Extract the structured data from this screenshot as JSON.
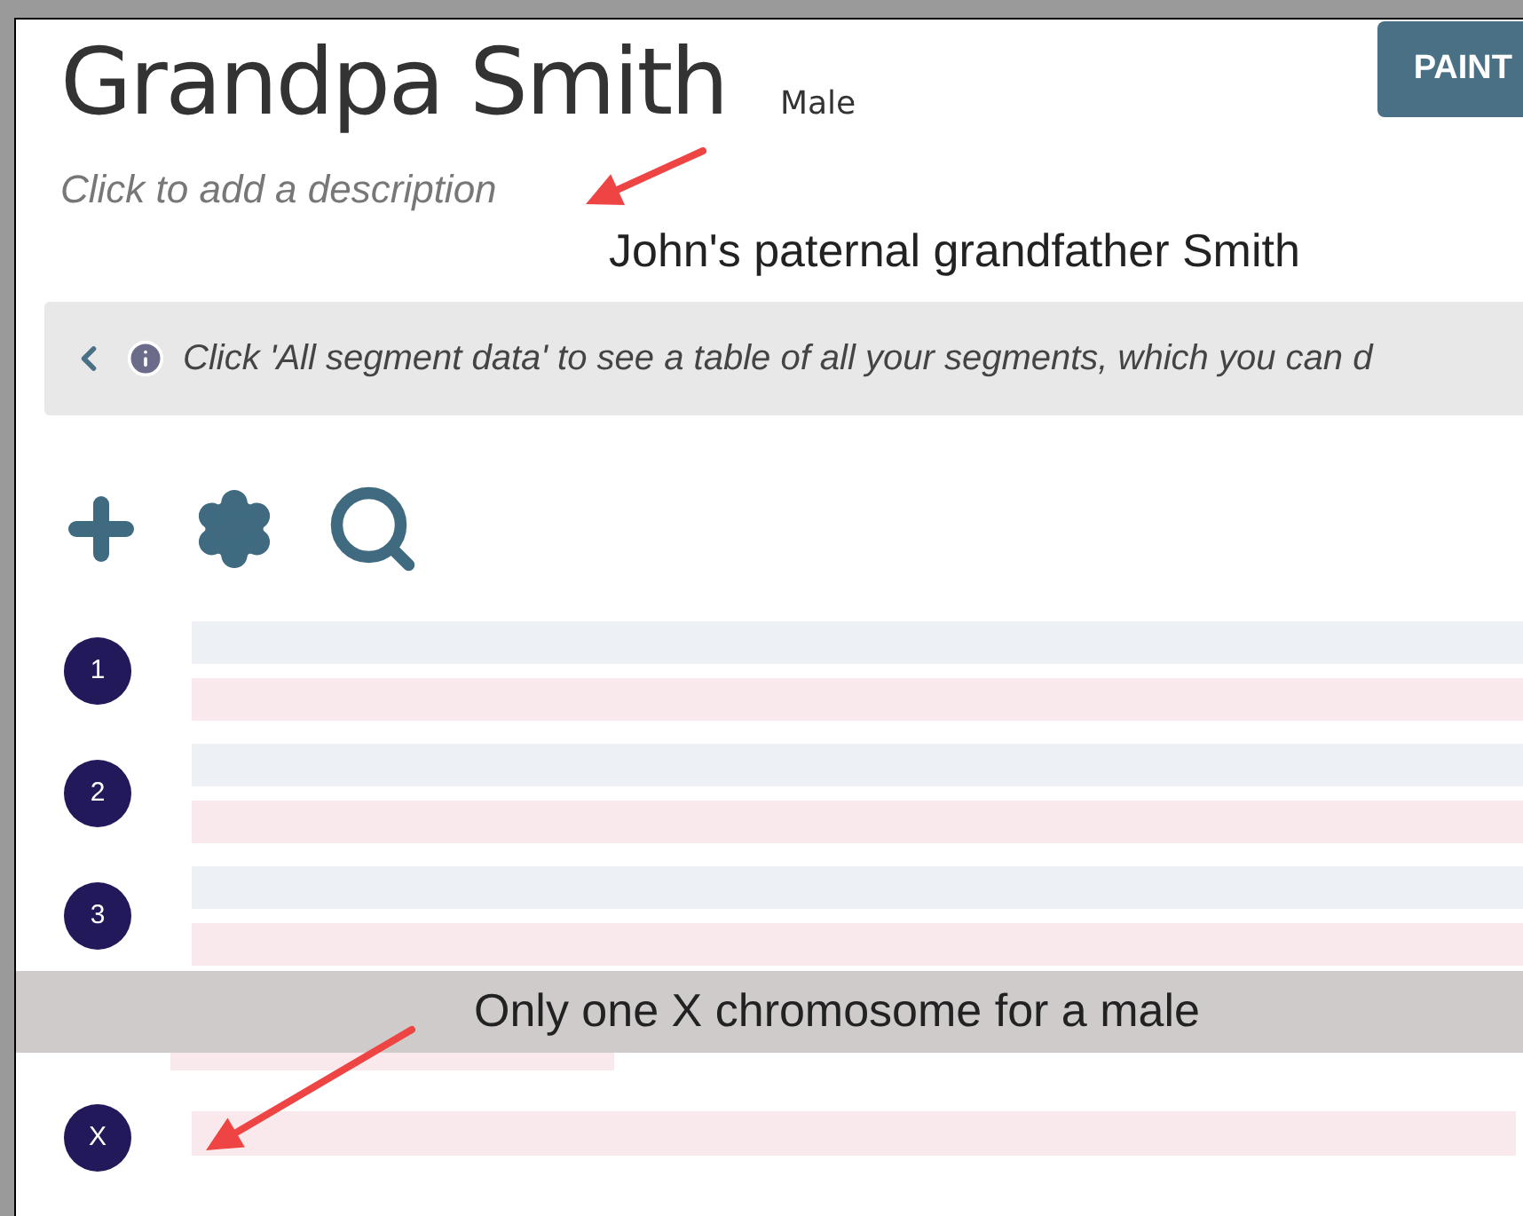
{
  "header": {
    "name": "Grandpa Smith",
    "sex": "Male",
    "button": "PAINT"
  },
  "description": {
    "placeholder": "Click to add a description"
  },
  "annotations": [
    {
      "text": "John's paternal grandfather Smith"
    },
    {
      "text": "Only one X chromosome for a male"
    }
  ],
  "info_bar": {
    "text": "Click 'All segment data' to see a table of all your segments, which you can d"
  },
  "chromosomes": [
    {
      "label": "1",
      "kind": "pair"
    },
    {
      "label": "2",
      "kind": "pair"
    },
    {
      "label": "3",
      "kind": "pair"
    },
    {
      "label": "X",
      "kind": "single"
    }
  ]
}
